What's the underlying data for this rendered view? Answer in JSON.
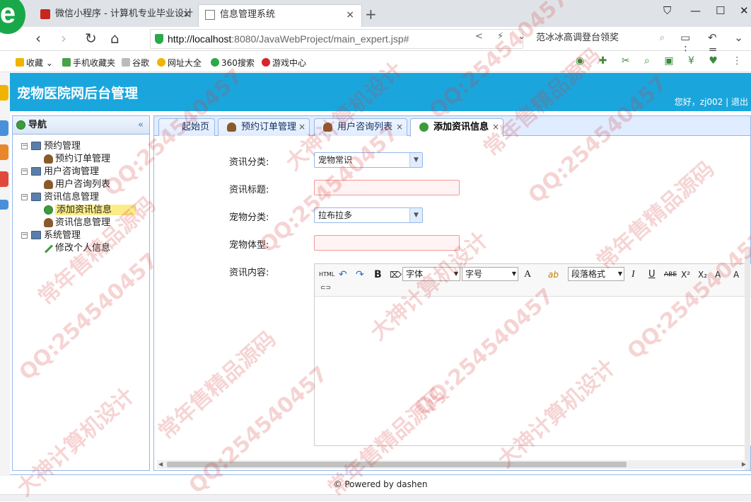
{
  "browser": {
    "logo": "e",
    "tabs": [
      {
        "title": "微信小程序 - 计算机专业毕业设计",
        "close": "×"
      },
      {
        "title": "信息管理系统",
        "close": "×"
      }
    ],
    "new_tab": "+",
    "window_controls": {
      "pin": "⛉",
      "minimize": "—",
      "maximize": "☐",
      "close": "✕"
    },
    "nav": {
      "back": "‹",
      "forward": "›",
      "reload": "↻",
      "home": "⌂"
    },
    "url": {
      "host": "http://localhost",
      "rest": ":8080/JavaWebProject/main_expert.jsp#"
    },
    "url_icons": "< ⚡ ⌄",
    "search_text": "范冰冰高调登台领奖",
    "search_icon": "⌕",
    "toolbar_icons": "▭ ↶ ⌄ ⋮ ≡"
  },
  "bookmarks": [
    {
      "label": "收藏 ⌄",
      "color": "#f0b400"
    },
    {
      "label": "手机收藏夹",
      "color": "#4aa24a"
    },
    {
      "label": "谷歌",
      "color": "#bbbbbb"
    },
    {
      "label": "网址大全",
      "color": "#f0b400"
    },
    {
      "label": "360搜索",
      "color": "#2aaa4a"
    },
    {
      "label": "游戏中心",
      "color": "#d6262b"
    }
  ],
  "bookmark_icons": "◉ ✚ ✂ ⌕ ▣ ¥ ♥ ⋮",
  "app": {
    "title": "宠物医院网后台管理",
    "greeting": "您好，zj002 | 退出"
  },
  "sidebar": {
    "title": "导航",
    "collapse": "«",
    "groups": [
      {
        "label": "预约管理",
        "items": [
          {
            "label": "预约订单管理",
            "icon": "user"
          }
        ]
      },
      {
        "label": "用户咨询管理",
        "items": [
          {
            "label": "用户咨询列表",
            "icon": "user"
          }
        ]
      },
      {
        "label": "资讯信息管理",
        "items": [
          {
            "label": "添加资讯信息",
            "icon": "add",
            "selected": true
          },
          {
            "label": "资讯信息管理",
            "icon": "user"
          }
        ]
      },
      {
        "label": "系统管理",
        "items": [
          {
            "label": "修改个人信息",
            "icon": "edit"
          }
        ]
      }
    ]
  },
  "tabs": [
    {
      "label": "起始页",
      "closable": false
    },
    {
      "label": "预约订单管理",
      "close": "×"
    },
    {
      "label": "用户咨询列表",
      "close": "×"
    },
    {
      "label": "添加资讯信息",
      "close": "×",
      "active": true
    }
  ],
  "form": {
    "category_label": "资讯分类:",
    "category_value": "宠物常识",
    "title_label": "资讯标题:",
    "title_value": "",
    "pet_type_label": "宠物分类:",
    "pet_type_value": "拉布拉多",
    "body_type_label": "宠物体型:",
    "body_type_value": "",
    "content_label": "资讯内容:"
  },
  "editor": {
    "html": "HTML",
    "undo": "↶",
    "redo": "↷",
    "bold": "B",
    "format": "⌦",
    "font": "字体",
    "size": "字号",
    "color": "A",
    "bgcolor": "ab",
    "paragraph": "段落格式",
    "italic": "I",
    "underline": "U",
    "strike": "ABE",
    "sup": "X²",
    "sub": "X₂",
    "a1": "A",
    "a2": "A",
    "link": "⊂⊃"
  },
  "footer": "© Powered by dashen",
  "watermarks": [
    "QQ:254540457",
    "常年售精品源码",
    "大神计算机设计"
  ]
}
